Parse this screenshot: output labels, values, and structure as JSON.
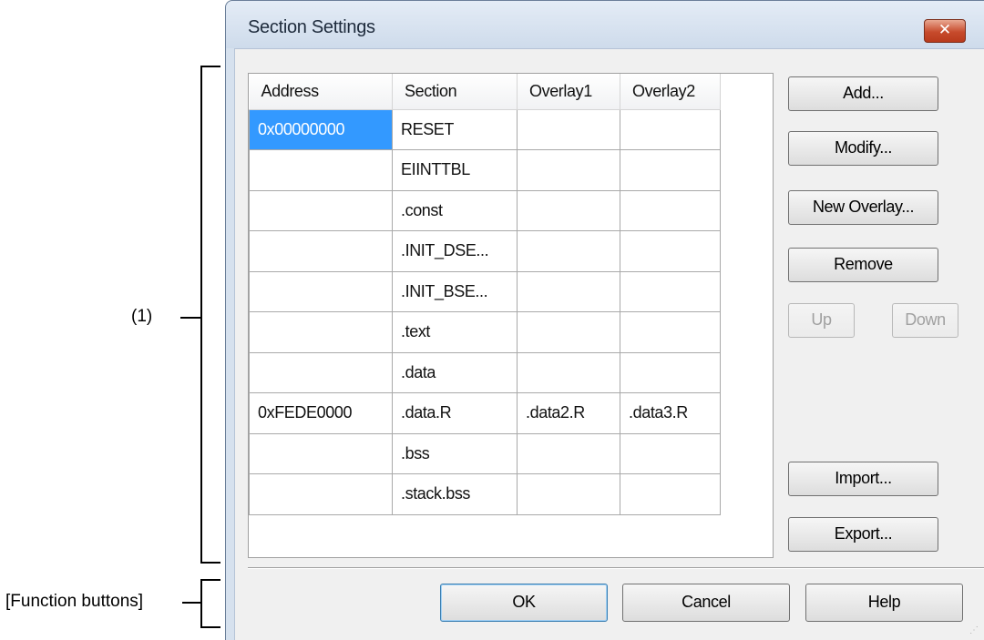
{
  "annotations": {
    "region1_label": "(1)",
    "function_buttons_label": "[Function buttons]"
  },
  "dialog": {
    "title": "Section Settings",
    "close_glyph": "✕"
  },
  "grid": {
    "columns": [
      "Address",
      "Section",
      "Overlay1",
      "Overlay2"
    ],
    "rows": [
      {
        "address": "0x00000000",
        "section": "RESET",
        "overlay1": "",
        "overlay2": "",
        "selected": true
      },
      {
        "address": "",
        "section": "EIINTTBL",
        "overlay1": "",
        "overlay2": ""
      },
      {
        "address": "",
        "section": ".const",
        "overlay1": "",
        "overlay2": ""
      },
      {
        "address": "",
        "section": ".INIT_DSE...",
        "overlay1": "",
        "overlay2": ""
      },
      {
        "address": "",
        "section": ".INIT_BSE...",
        "overlay1": "",
        "overlay2": ""
      },
      {
        "address": "",
        "section": ".text",
        "overlay1": "",
        "overlay2": ""
      },
      {
        "address": "",
        "section": ".data",
        "overlay1": "",
        "overlay2": ""
      },
      {
        "address": "0xFEDE0000",
        "section": ".data.R",
        "overlay1": ".data2.R",
        "overlay2": ".data3.R"
      },
      {
        "address": "",
        "section": ".bss",
        "overlay1": "",
        "overlay2": ""
      },
      {
        "address": "",
        "section": ".stack.bss",
        "overlay1": "",
        "overlay2": ""
      }
    ]
  },
  "side_buttons": {
    "add": "Add...",
    "modify": "Modify...",
    "new_overlay": "New Overlay...",
    "remove": "Remove",
    "up": "Up",
    "down": "Down",
    "import": "Import...",
    "export": "Export..."
  },
  "function_buttons": {
    "ok": "OK",
    "cancel": "Cancel",
    "help": "Help"
  },
  "colors": {
    "selection": "#3399ff",
    "close_button": "#c74b2c"
  }
}
